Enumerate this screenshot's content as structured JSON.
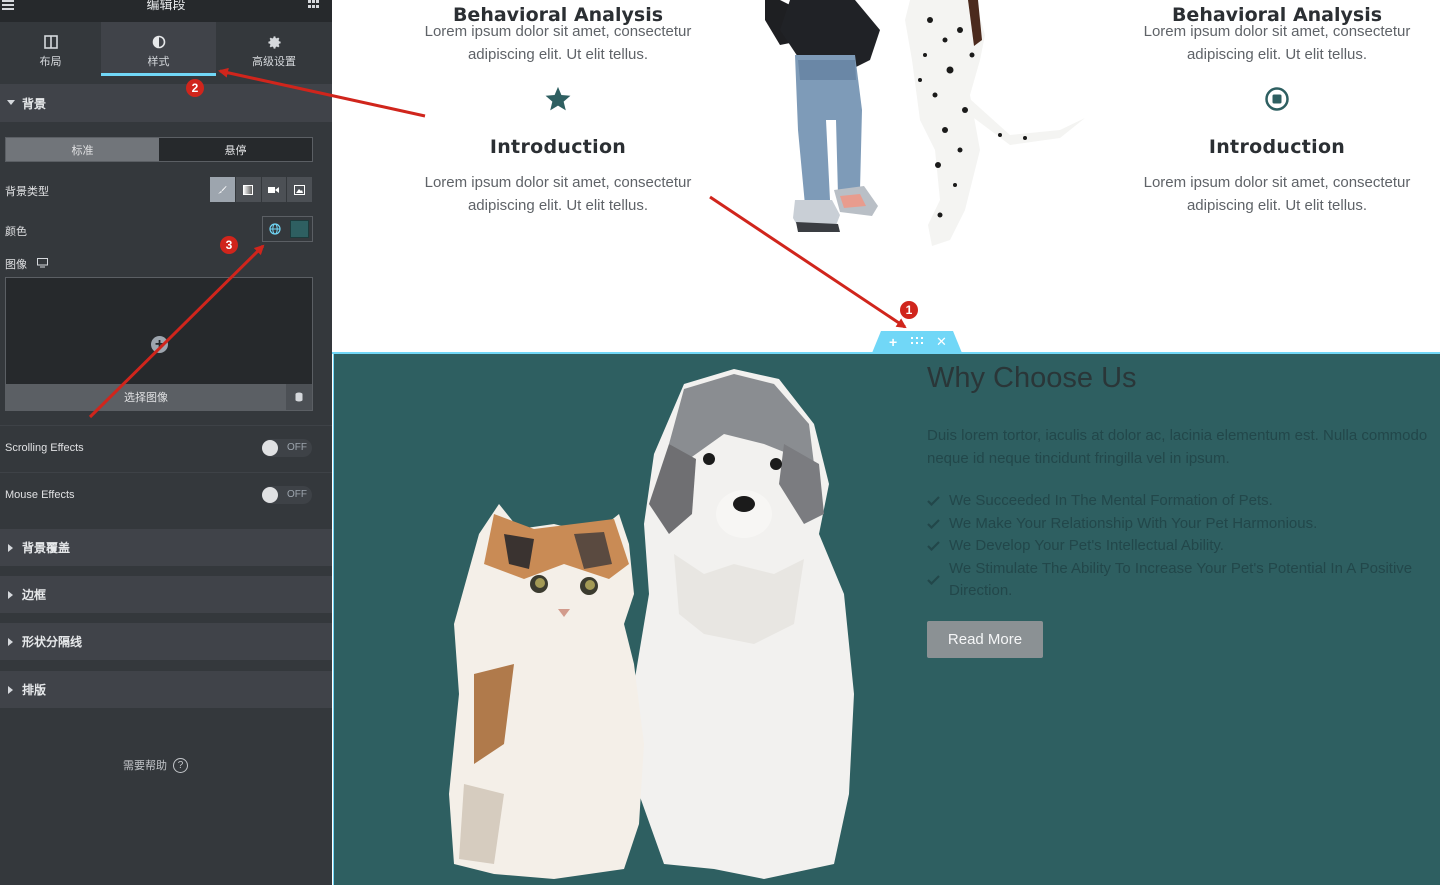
{
  "editor": {
    "title": "编辑段",
    "tabs": [
      {
        "label": "布局",
        "icon": "columns-icon"
      },
      {
        "label": "样式",
        "icon": "half-circle-icon"
      },
      {
        "label": "高级设置",
        "icon": "gear-icon"
      }
    ],
    "active_tab": "样式",
    "background_section": "背景",
    "state_tabs": [
      "标准",
      "悬停"
    ],
    "bg_type_label": "背景类型",
    "bg_type_options": [
      "brush-icon",
      "gradient-icon",
      "video-icon",
      "slideshow-icon"
    ],
    "color_label": "颜色",
    "color_value": "#2e5f61",
    "image_label": "图像",
    "choose_image": "选择图像",
    "scrolling_effects": {
      "label": "Scrolling Effects",
      "state": "OFF"
    },
    "mouse_effects": {
      "label": "Mouse Effects",
      "state": "OFF"
    },
    "collapsed_sections": [
      "背景覆盖",
      "边框",
      "形状分隔线",
      "排版"
    ],
    "help": "需要帮助",
    "help_icon": "?"
  },
  "canvas": {
    "features_left": {
      "top_title": "Behavioral Analysis",
      "top_desc": "Lorem ipsum dolor sit amet, consectetur adipiscing elit. Ut elit tellus.",
      "title": "Introduction",
      "desc": "Lorem ipsum dolor sit amet, consectetur adipiscing elit. Ut elit tellus."
    },
    "features_right": {
      "top_title": "Behavioral Analysis",
      "top_desc": "Lorem ipsum dolor sit amet, consectetur adipiscing elit. Ut elit tellus.",
      "title": "Introduction",
      "desc": "Lorem ipsum dolor sit amet, consectetur adipiscing elit. Ut elit tellus."
    },
    "why": {
      "title": "Why Choose Us",
      "body_line1": "Duis lorem tortor, iaculis at dolor ac, lacinia elementum est. Nulla commodo",
      "body_line2": "neque id neque tincidunt fringilla vel in ipsum.",
      "items": [
        "We Succeeded In The Mental Formation of Pets.",
        "We Make Your Relationship With Your Pet Harmonious.",
        "We Develop Your Pet's Intellectual Ability.",
        "We Stimulate The Ability To Increase Your Pet's Potential In A Positive Direction."
      ],
      "button": "Read More"
    }
  },
  "annotations": [
    "1",
    "2",
    "3"
  ],
  "colors": {
    "panel": "#34383c",
    "accent": "#71d7f7",
    "section_bg": "#2e5f61",
    "arrow": "#d0251c"
  }
}
